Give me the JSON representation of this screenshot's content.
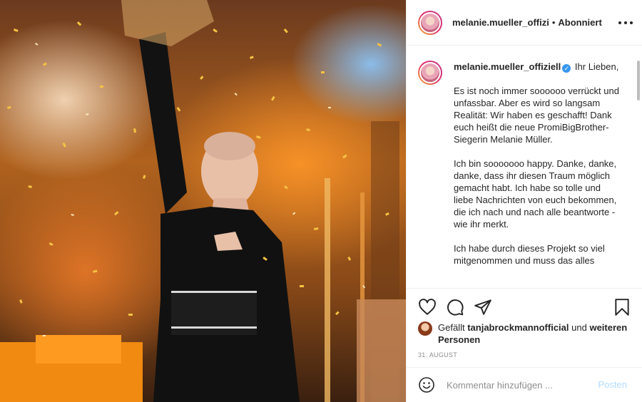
{
  "header": {
    "username": "melanie.mueller_offizi",
    "separator": "•",
    "follow_status": "Abonniert"
  },
  "caption": {
    "username": "melanie.mueller_offiziell",
    "verified_icon": "verified-badge-icon",
    "paragraphs": [
      "Ihr Lieben,",
      "Es ist noch immer soooooo verrückt und unfassbar. Aber es wird so langsam Realität: Wir haben es geschafft! Dank euch heißt die neue PromiBigBrother-Siegerin Melanie Müller.",
      "Ich bin sooooooo happy. Danke, danke, danke, dass ihr diesen Traum möglich gemacht habt. Ich habe so tolle und liebe Nachrichten von euch bekommen, die ich nach und nach alle beantworte - wie ihr merkt.",
      "Ich habe durch dieses Projekt so viel mitgenommen und muss das alles"
    ]
  },
  "actions": {
    "like_icon": "heart-icon",
    "comment_icon": "comment-bubble-icon",
    "share_icon": "paper-plane-icon",
    "save_icon": "bookmark-icon"
  },
  "likes": {
    "prefix": "Gefällt",
    "user": "tanjabrockmannofficial",
    "connector": "und",
    "others": "weiteren Personen"
  },
  "date": "31. AUGUST",
  "comment_bar": {
    "emoji_icon": "smiley-icon",
    "placeholder": "Kommentar hinzufügen ...",
    "post_label": "Posten"
  },
  "colors": {
    "accent": "#3897f0",
    "post_disabled": "#b3dbff",
    "text": "#262626",
    "muted": "#8e8e8e"
  }
}
